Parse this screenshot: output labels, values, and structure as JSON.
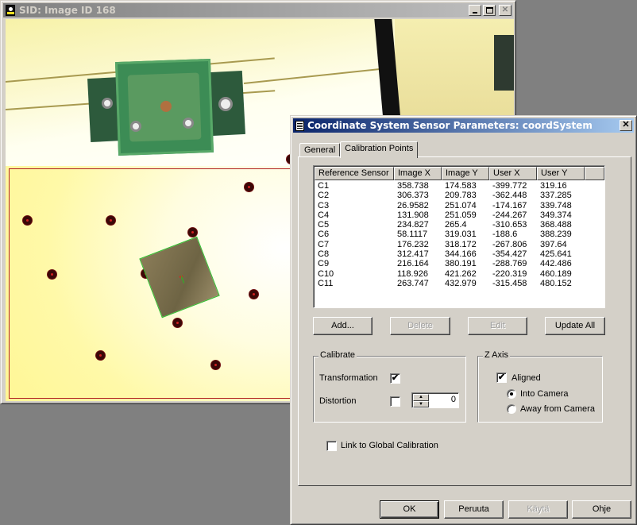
{
  "image_window": {
    "title": "SID: Image ID 168",
    "buttons": {
      "minimize": "minimize",
      "maximize": "maximize",
      "close": "✕"
    }
  },
  "dialog": {
    "title": "Coordinate System Sensor Parameters: coordSystem",
    "close_label": "✕",
    "tabs": [
      {
        "label": "General",
        "active": false
      },
      {
        "label": "Calibration Points",
        "active": true
      }
    ],
    "table": {
      "columns": [
        "Reference Sensor",
        "Image X",
        "Image Y",
        "User X",
        "User Y"
      ],
      "rows": [
        [
          "C1",
          "358.738",
          "174.583",
          "-399.772",
          "319.16"
        ],
        [
          "C2",
          "306.373",
          "209.783",
          "-362.448",
          "337.285"
        ],
        [
          "C3",
          "26.9582",
          "251.074",
          "-174.167",
          "339.748"
        ],
        [
          "C4",
          "131.908",
          "251.059",
          "-244.267",
          "349.374"
        ],
        [
          "C5",
          "234.827",
          "265.4",
          "-310.653",
          "368.488"
        ],
        [
          "C6",
          "58.1117",
          "319.031",
          "-188.6",
          "388.239"
        ],
        [
          "C7",
          "176.232",
          "318.172",
          "-267.806",
          "397.64"
        ],
        [
          "C8",
          "312.417",
          "344.166",
          "-354.427",
          "425.641"
        ],
        [
          "C9",
          "216.164",
          "380.191",
          "-288.769",
          "442.486"
        ],
        [
          "C10",
          "118.926",
          "421.262",
          "-220.319",
          "460.189"
        ],
        [
          "C11",
          "263.747",
          "432.979",
          "-315.458",
          "480.152"
        ]
      ]
    },
    "list_buttons": {
      "add": "Add...",
      "delete": "Delete",
      "edit": "Edit",
      "update_all": "Update All"
    },
    "calibrate": {
      "label": "Calibrate",
      "transformation_label": "Transformation",
      "transformation_checked": true,
      "distortion_label": "Distortion",
      "distortion_checked": false,
      "distortion_value": "0"
    },
    "z_axis": {
      "label": "Z Axis",
      "aligned_label": "Aligned",
      "aligned_checked": true,
      "into_camera_label": "Into Camera",
      "away_label": "Away from Camera",
      "selected": "Into Camera"
    },
    "link_global_label": "Link to Global Calibration",
    "link_global_checked": false,
    "footer": {
      "ok": "OK",
      "cancel": "Peruuta",
      "apply": "Käytä",
      "help": "Ohje"
    },
    "check_mark": "✔"
  }
}
